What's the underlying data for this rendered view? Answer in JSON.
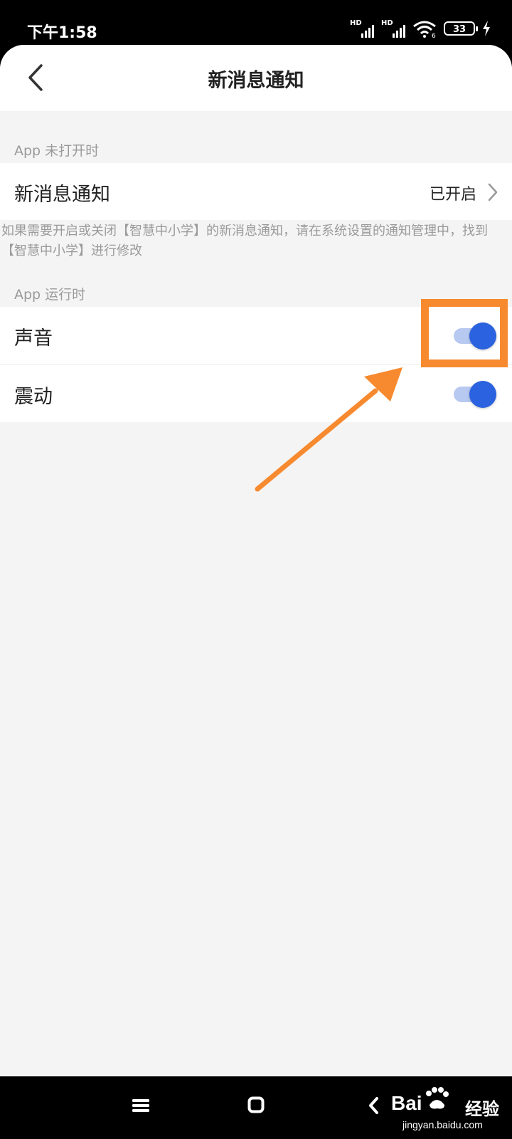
{
  "status_bar": {
    "time": "下午1:58",
    "signal_1_label": "HD",
    "signal_2_label": "HD",
    "wifi_badge": "6",
    "battery_level": "33",
    "icons": [
      "signal-icon",
      "signal-icon",
      "wifi-icon",
      "battery-icon",
      "charging-icon"
    ]
  },
  "header": {
    "title": "新消息通知",
    "back_icon": "chevron-left-icon"
  },
  "sections": {
    "closed": {
      "header": "App 未打开时",
      "notification_row": {
        "label": "新消息通知",
        "value": "已开启"
      },
      "hint": "如果需要开启或关闭【智慧中小学】的新消息通知，请在系统设置的通知管理中，找到【智慧中小学】进行修改"
    },
    "running": {
      "header": "App 运行时",
      "sound_row": {
        "label": "声音",
        "enabled": true
      },
      "vibrate_row": {
        "label": "震动",
        "enabled": true
      }
    }
  },
  "annotation": {
    "color": "#f78a2f"
  },
  "colors": {
    "toggle_on": "#2a62e0",
    "toggle_track": "#b7c8f1",
    "background": "#f4f4f4"
  },
  "nav_bar": {
    "icons": [
      "menu-icon",
      "home-icon",
      "back-icon"
    ]
  },
  "watermark": {
    "brand": "Bai",
    "brand_suffix": "经验",
    "url": "jingyan.baidu.com"
  }
}
